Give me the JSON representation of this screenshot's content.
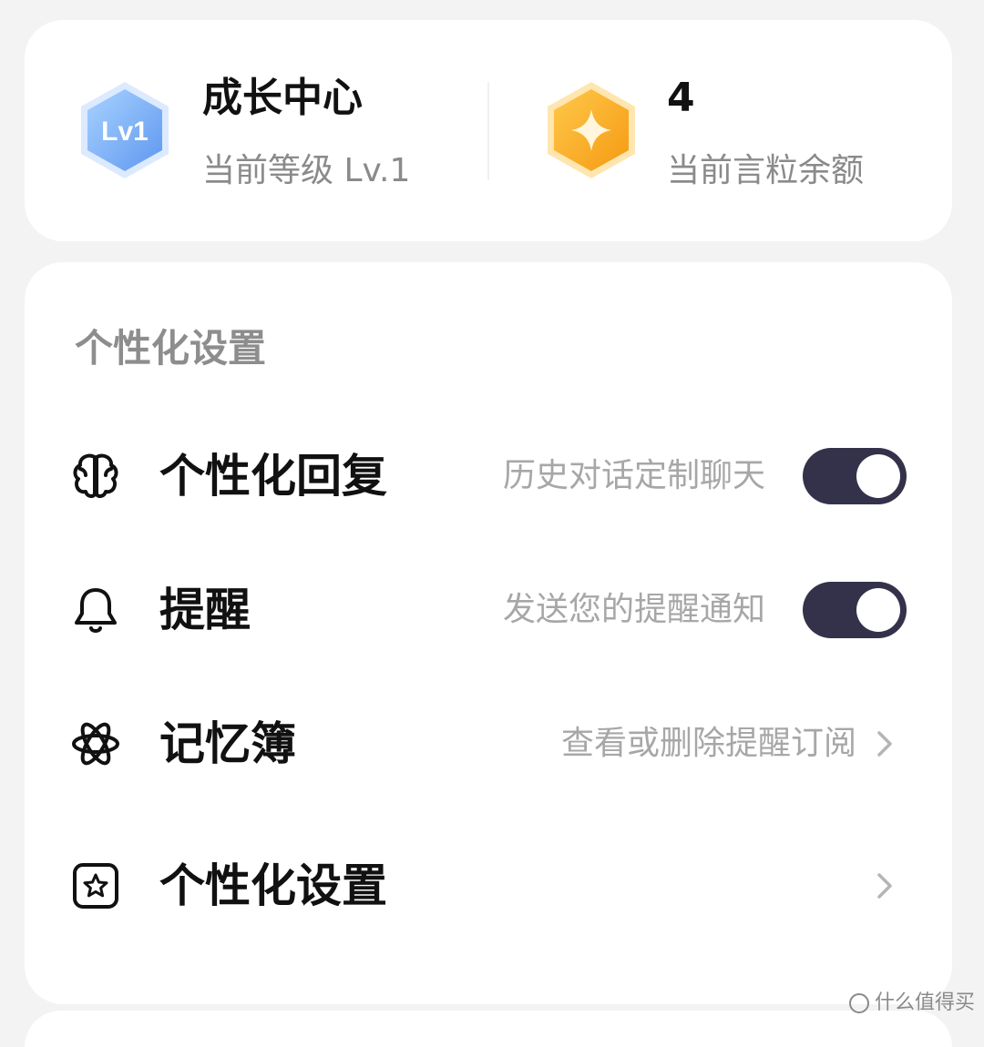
{
  "top_card": {
    "level_badge_text": "Lv1",
    "growth_title": "成长中心",
    "growth_sub": "当前等级 Lv.1",
    "coin_value": "4",
    "coin_sub": "当前言粒余额"
  },
  "settings": {
    "section_title": "个性化设置",
    "rows": [
      {
        "icon": "brain-icon",
        "label": "个性化回复",
        "desc": "历史对话定制聊天",
        "control": "toggle",
        "on": true
      },
      {
        "icon": "bell-icon",
        "label": "提醒",
        "desc": "发送您的提醒通知",
        "control": "toggle",
        "on": true
      },
      {
        "icon": "atom-icon",
        "label": "记忆簿",
        "desc": "查看或删除提醒订阅",
        "control": "chevron"
      },
      {
        "icon": "star-square-icon",
        "label": "个性化设置",
        "desc": "",
        "control": "chevron"
      }
    ]
  },
  "watermark": "什么值得买",
  "colors": {
    "toggle_on": "#34324a",
    "level_badge": "#7ab0f5",
    "coin_badge": "#f8ac2a"
  }
}
